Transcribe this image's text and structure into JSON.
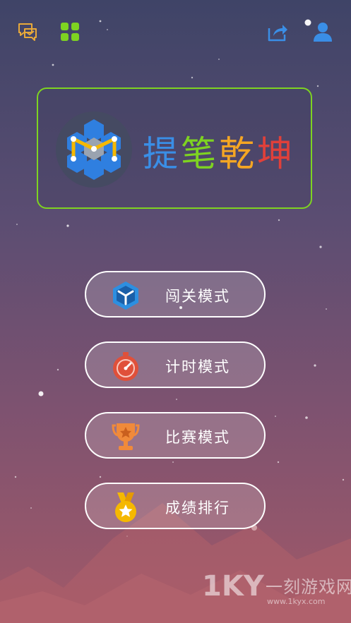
{
  "app": {
    "title_chars": [
      "提",
      "笔",
      "乾",
      "坤"
    ],
    "title_colors": [
      "#3a8ee6",
      "#7ed321",
      "#f5a623",
      "#e0403a"
    ]
  },
  "topbar": {
    "feedback_icon": "chat-bubbles-icon",
    "more_games_icon": "grid-icon",
    "share_icon": "share-icon",
    "profile_icon": "user-icon"
  },
  "menu": [
    {
      "label": "闯关模式",
      "icon": "cube-icon",
      "icon_color": "#2d8fe0"
    },
    {
      "label": "计时模式",
      "icon": "stopwatch-icon",
      "icon_color": "#e0503a"
    },
    {
      "label": "比赛模式",
      "icon": "trophy-icon",
      "icon_color": "#f08a3a"
    },
    {
      "label": "成绩排行",
      "icon": "medal-icon",
      "icon_color": "#f5b800"
    }
  ],
  "colors": {
    "accent_green": "#7ed321",
    "icon_gold": "#e8a93a",
    "icon_blue": "#3a8ee6"
  },
  "watermark": {
    "brand": "1KY",
    "site_name": "一刻游戏网",
    "url": "www.1kyx.com"
  }
}
